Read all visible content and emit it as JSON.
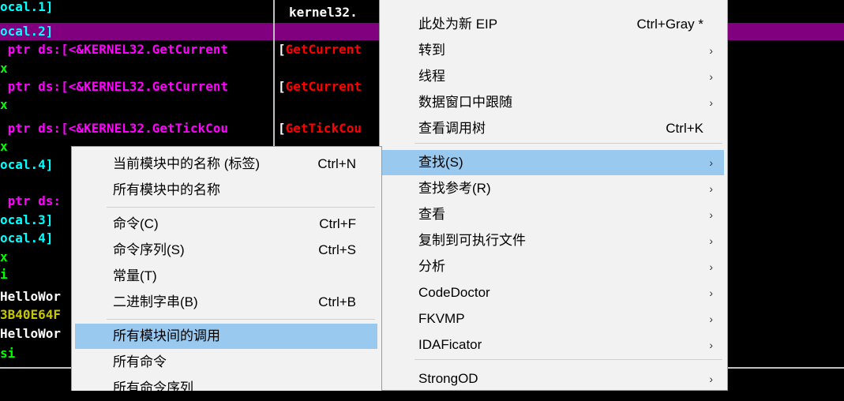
{
  "colors": {
    "background": "#000000",
    "highlight_line": "#800080",
    "menu_bg": "#f2f2f2",
    "menu_selected": "#99c9ef"
  },
  "code": {
    "lines": [
      {
        "text": "ocal.1]",
        "color": "#00ffff"
      },
      {
        "text": "ocal.2]",
        "color": "#00ffff"
      },
      {
        "text": " ptr ds:[<&KERNEL32.GetCurrent",
        "color": "#ff00ff"
      },
      {
        "text": "x",
        "color": "#00ff00"
      },
      {
        "text": " ptr ds:[<&KERNEL32.GetCurrent",
        "color": "#ff00ff"
      },
      {
        "text": "x",
        "color": "#00ff00"
      },
      {
        "text": " ptr ds:[<&KERNEL32.GetTickCou",
        "color": "#ff00ff"
      },
      {
        "text": "x",
        "color": "#00ff00"
      },
      {
        "text": "ocal.4]",
        "color": "#00ffff"
      },
      {
        "text": "",
        "color": "#00ffff"
      },
      {
        "text": " ptr ds:",
        "color": "#ff00ff"
      },
      {
        "text": "ocal.3]",
        "color": "#00ffff"
      },
      {
        "text": "ocal.4]",
        "color": "#00ffff"
      },
      {
        "text": "x",
        "color": "#00ff00"
      },
      {
        "text": "i",
        "color": "#00ff00"
      },
      {
        "text": "HelloWor",
        "color": "#ffffff"
      },
      {
        "text": "3B40E64F",
        "color": "#c8c800"
      },
      {
        "text": "HelloWor",
        "color": "#ffffff"
      },
      {
        "text": "si",
        "color": "#00ff00"
      }
    ],
    "comments": [
      {
        "text": "kernel32.",
        "color": "#ffffff",
        "bracket": ""
      },
      {
        "text": "GetCurrent",
        "color": "#ff0000",
        "bracket": "["
      },
      {
        "text": "GetCurrent",
        "color": "#ff0000",
        "bracket": "["
      },
      {
        "text": "GetTickCou",
        "color": "#ff0000",
        "bracket": "["
      }
    ]
  },
  "context_menu_main": {
    "items": [
      {
        "label": "此处为新 EIP",
        "shortcut": "Ctrl+Gray *",
        "submenu": false
      },
      {
        "label": "转到",
        "shortcut": "",
        "submenu": true
      },
      {
        "label": "线程",
        "shortcut": "",
        "submenu": true
      },
      {
        "label": "数据窗口中跟随",
        "shortcut": "",
        "submenu": true
      },
      {
        "label": "查看调用树",
        "shortcut": "Ctrl+K",
        "submenu": false
      },
      {
        "label": "查找(S)",
        "shortcut": "",
        "submenu": true,
        "selected": true
      },
      {
        "label": "查找参考(R)",
        "shortcut": "",
        "submenu": true
      },
      {
        "label": "查看",
        "shortcut": "",
        "submenu": true
      },
      {
        "label": "复制到可执行文件",
        "shortcut": "",
        "submenu": true
      },
      {
        "label": "分析",
        "shortcut": "",
        "submenu": true
      },
      {
        "label": "CodeDoctor",
        "shortcut": "",
        "submenu": true
      },
      {
        "label": "FKVMP",
        "shortcut": "",
        "submenu": true
      },
      {
        "label": "IDAFicator",
        "shortcut": "",
        "submenu": true
      },
      {
        "label": "StrongOD",
        "shortcut": "",
        "submenu": true
      }
    ],
    "arrow_glyph": "›"
  },
  "context_menu_sub": {
    "items": [
      {
        "label": "当前模块中的名称 (标签)",
        "shortcut": "Ctrl+N"
      },
      {
        "label": "所有模块中的名称",
        "shortcut": ""
      },
      {
        "label": "命令(C)",
        "shortcut": "Ctrl+F"
      },
      {
        "label": "命令序列(S)",
        "shortcut": "Ctrl+S"
      },
      {
        "label": "常量(T)",
        "shortcut": ""
      },
      {
        "label": "二进制字串(B)",
        "shortcut": "Ctrl+B"
      },
      {
        "label": "所有模块间的调用",
        "shortcut": "",
        "selected": true
      },
      {
        "label": "所有命令",
        "shortcut": ""
      },
      {
        "label": "所有命令序列",
        "shortcut": ""
      }
    ]
  }
}
